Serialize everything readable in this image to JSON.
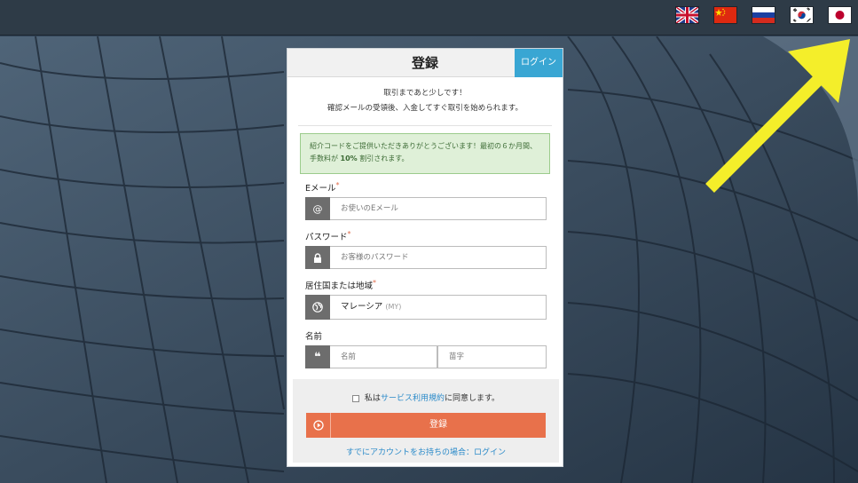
{
  "languages": [
    {
      "name": "uk-flag-icon",
      "code": "en"
    },
    {
      "name": "cn-flag-icon",
      "code": "zh"
    },
    {
      "name": "ru-flag-icon",
      "code": "ru"
    },
    {
      "name": "kr-flag-icon",
      "code": "ko"
    },
    {
      "name": "jp-flag-icon",
      "code": "ja"
    }
  ],
  "card": {
    "title": "登録",
    "login_tab": "ログイン",
    "subtitle_line1": "取引まであと少しです！",
    "subtitle_line2": "確認メールの受領後、入金してすぐ取引を始められます。",
    "promo_part1": "紹介コードをご提供いただきありがとうございます！最初の６か月間、手数料が ",
    "promo_bold": "10%",
    "promo_part2": " 割引されます。"
  },
  "form": {
    "email_label": "Eメール",
    "email_placeholder": "お使いのEメール",
    "password_label": "パスワード",
    "password_placeholder": "お客様のパスワード",
    "country_label": "居住国または地域",
    "country_value": "マレーシア",
    "country_code": "(MY)",
    "name_label": "名前",
    "first_name_placeholder": "名前",
    "last_name_placeholder": "苗字",
    "required_mark": "*"
  },
  "footer": {
    "agree_prefix": "私は",
    "agree_link": "サービス利用規約",
    "agree_suffix": "に同意します。",
    "submit_label": "登録",
    "have_account": "すでにアカウントをお持ちの場合：ログイン"
  },
  "colors": {
    "accent_orange": "#e8714b",
    "accent_blue": "#39a6d3",
    "promo_green": "#dff0d8",
    "arrow_yellow": "#f4ee2a"
  }
}
